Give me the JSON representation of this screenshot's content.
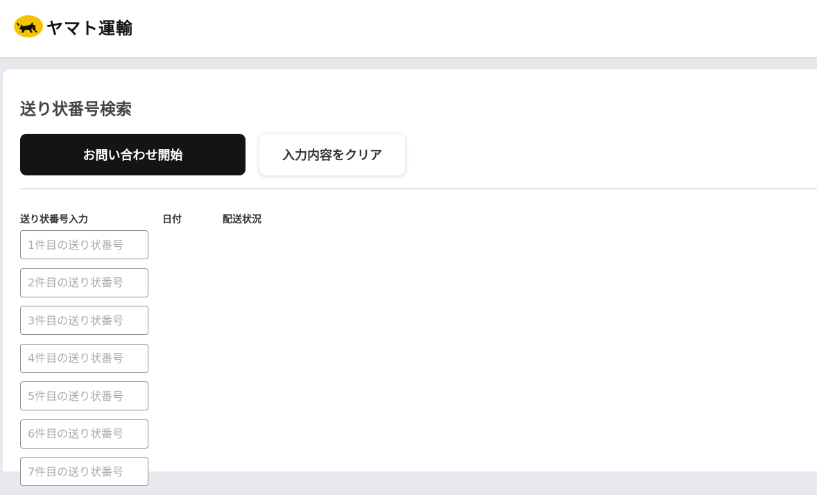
{
  "header": {
    "logo_text": "ヤマト運輸",
    "logo_icon": "black-cat-icon",
    "brand_yellow": "#f5c400"
  },
  "search": {
    "title": "送り状番号検索",
    "start_button": "お問い合わせ開始",
    "clear_button": "入力内容をクリア",
    "columns": {
      "tracking_input": "送り状番号入力",
      "date": "日付",
      "status": "配送状況"
    },
    "inputs": [
      {
        "value": "",
        "placeholder": "1件目の送り状番号"
      },
      {
        "value": "",
        "placeholder": "2件目の送り状番号"
      },
      {
        "value": "",
        "placeholder": "3件目の送り状番号"
      },
      {
        "value": "",
        "placeholder": "4件目の送り状番号"
      },
      {
        "value": "",
        "placeholder": "5件目の送り状番号"
      },
      {
        "value": "",
        "placeholder": "6件目の送り状番号"
      },
      {
        "value": "",
        "placeholder": "7件目の送り状番号"
      }
    ]
  },
  "colors": {
    "primary_button_bg": "#141414",
    "page_bg": "#e9e8ee"
  }
}
